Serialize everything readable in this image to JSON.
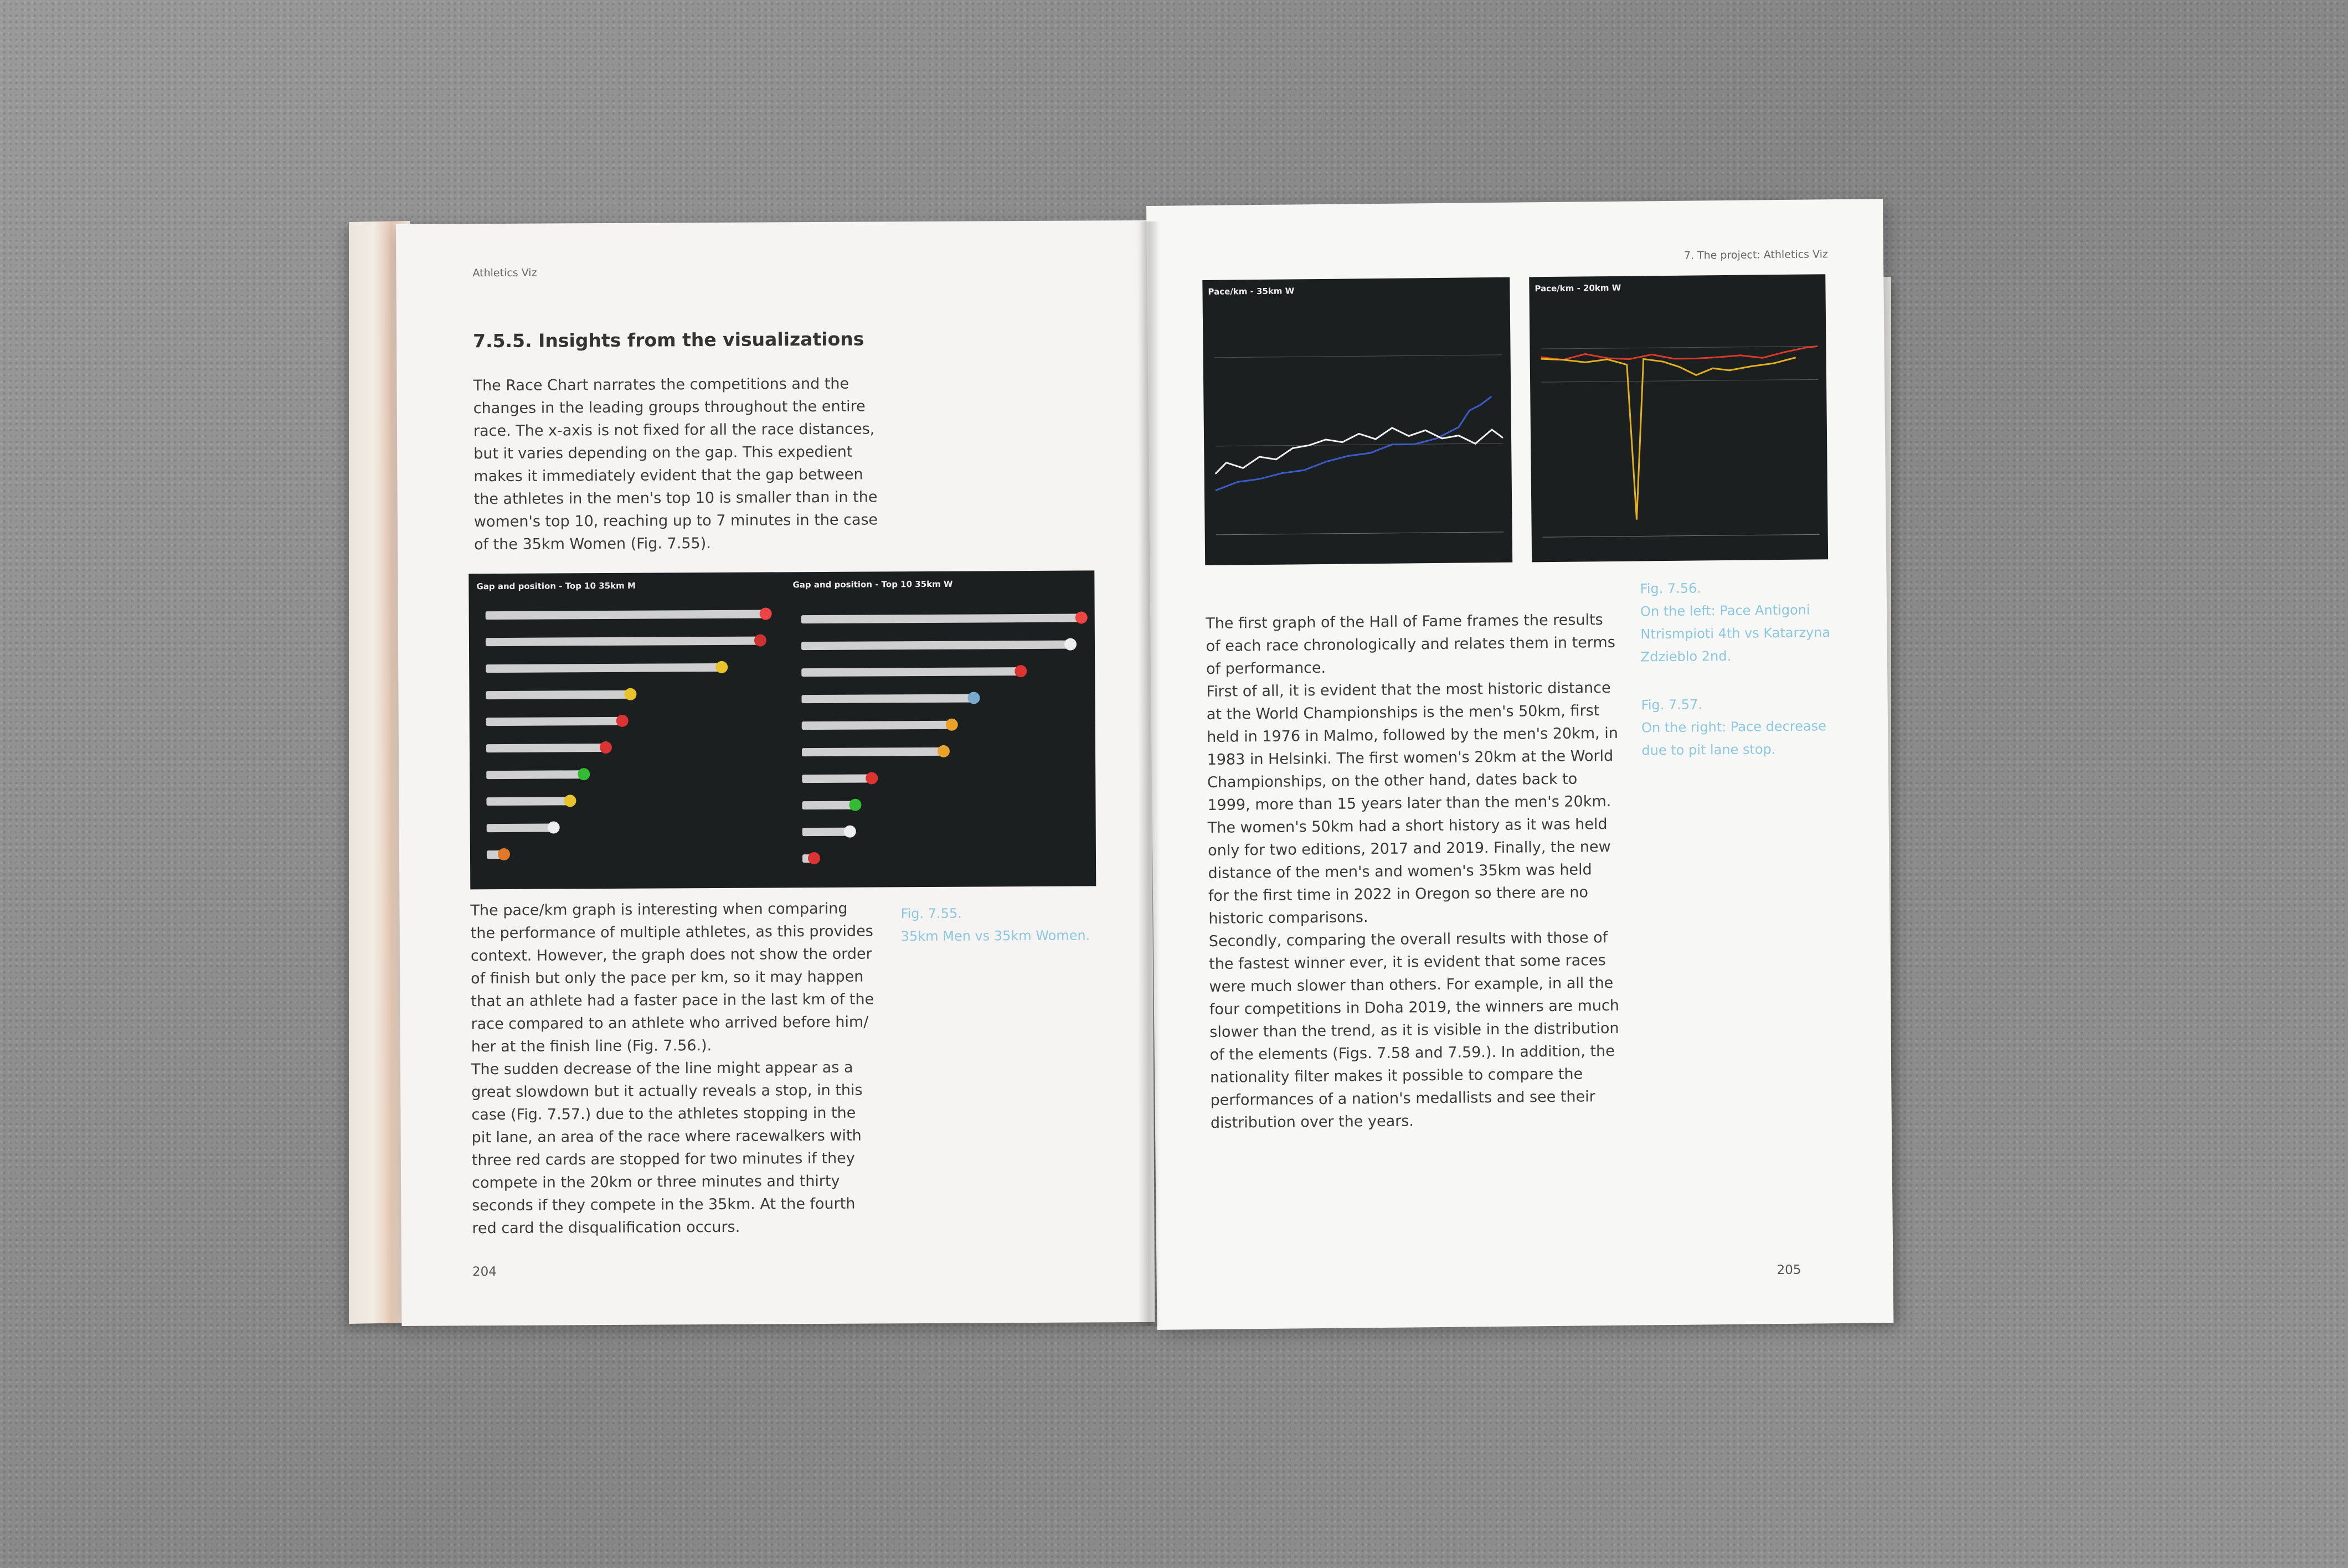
{
  "left_page": {
    "running_head": "Athletics Viz",
    "heading": "7.5.5.  Insights from the visualizations",
    "para1": "The Race Chart narrates the competitions and the\nchanges in the leading groups throughout the entire\nrace. The x-axis is not fixed for all the race distances,\nbut it varies depending on the gap. This expedient\nmakes it immediately evident that the gap between\nthe athletes in the men's top 10 is smaller than in the\nwomen's top 10, reaching up to 7 minutes in the case\nof the 35km Women (Fig. 7.55).",
    "fig_left_title": "Gap and position - Top 10",
    "fig_left_bold": "35km M",
    "fig_right_title": "Gap and position - Top 10",
    "fig_right_bold": "35km W",
    "para2": "The pace/km graph is interesting when comparing\nthe performance of multiple athletes, as this provides\ncontext.  However, the graph does not show the order\nof finish but only the pace per km, so it may happen\nthat an athlete had a faster pace in the last km of the\nrace compared to an athlete who arrived before him/\nher at the finish line (Fig. 7.56.).\nThe sudden decrease of the line might appear as a\ngreat slowdown but it actually reveals a stop, in this\ncase (Fig. 7.57.) due to the athletes stopping in the\npit lane, an area of the race where racewalkers with\nthree red cards are stopped for two minutes if they\ncompete in the 20km or three minutes and thirty\nseconds if they compete in the 35km. At the fourth\nred card the disqualification occurs.",
    "caption": "Fig. 7.55.\n35km Men vs 35km Women.",
    "page_number": "204"
  },
  "right_page": {
    "running_head": "7. The project: Athletics Viz",
    "chart1_title": "Pace/km - 35km W",
    "chart2_title": "Pace/km - 20km W",
    "para": "The first graph of the Hall of Fame frames the results\nof each race chronologically and relates them in terms\nof performance.\nFirst of all, it is evident that the most historic distance\nat the World Championships is the men's 50km, first\nheld in 1976 in Malmo, followed by the men's 20km, in\n1983 in Helsinki. The first women's 20km at the World\nChampionships, on the other hand, dates back to\n1999, more than 15 years later than the men's 20km.\nThe women's 50km had a short history as it was held\nonly for two editions, 2017 and 2019. Finally, the new\ndistance of the men's and women's 35km was held\nfor the first time in 2022 in Oregon so there are no\nhistoric comparisons.\nSecondly, comparing the overall results with those of\nthe fastest winner ever, it is evident that some races\nwere much slower than others. For example, in all the\nfour competitions in Doha 2019, the winners are much\nslower than the trend, as it is visible in the distribution\nof the elements (Figs. 7.58 and 7.59.). In addition, the\nnationality filter makes it possible to compare the\nperformances of a nation's medallists and see their\ndistribution over the years.",
    "caption1": "Fig. 7.56.\nOn the left: Pace Antigoni\nNtrismpioti 4th vs Katarzyna\nZdzieblo 2nd.",
    "caption2": "Fig. 7.57.\nOn the right: Pace decrease\ndue to pit lane stop.",
    "page_number": "205"
  },
  "colors": {
    "figure_bg": "#1c1f1f",
    "caption": "#8cc7df",
    "paper": "#f6f5f3"
  }
}
